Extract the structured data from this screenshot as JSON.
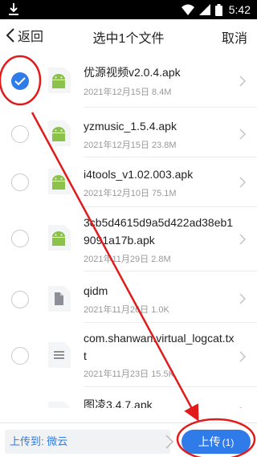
{
  "status": {
    "time": "5:42"
  },
  "header": {
    "back_label": "返回",
    "title": "选中1个文件",
    "cancel_label": "取消"
  },
  "files": [
    {
      "name": "优源视频v2.0.4.apk",
      "date": "2021年12月15日",
      "size": "8.4M",
      "icon": "android-apk-icon",
      "checked": true
    },
    {
      "name": "yzmusic_1.5.4.apk",
      "date": "2021年12月15日",
      "size": "23.8M",
      "icon": "android-apk-icon",
      "checked": false
    },
    {
      "name": "i4tools_v1.02.003.apk",
      "date": "2021年12月10日",
      "size": "75.1M",
      "icon": "android-apk-icon",
      "checked": false
    },
    {
      "name": "3cb5d4615d9a5d422ad38eb19091a17b.apk",
      "date": "2021年11月29日",
      "size": "2.8M",
      "icon": "android-apk-icon",
      "checked": false
    },
    {
      "name": "qidm",
      "date": "2021年11月26日",
      "size": "1.0K",
      "icon": "document-icon",
      "checked": false
    },
    {
      "name": "com.shanwan.virtual_logcat.txt",
      "date": "2021年11月23日",
      "size": "15.5K",
      "icon": "text-file-icon",
      "checked": false
    },
    {
      "name": "图凌3.4.7.apk",
      "date": "",
      "size": "",
      "icon": "android-apk-icon",
      "checked": false
    }
  ],
  "bottom": {
    "dest_prefix": "上传到: ",
    "dest_folder": "微云",
    "upload_label": "上传",
    "upload_count": "(1)"
  },
  "colors": {
    "accent": "#2f7bea",
    "annotation": "#e01b1b",
    "android": "#8bc34a"
  }
}
